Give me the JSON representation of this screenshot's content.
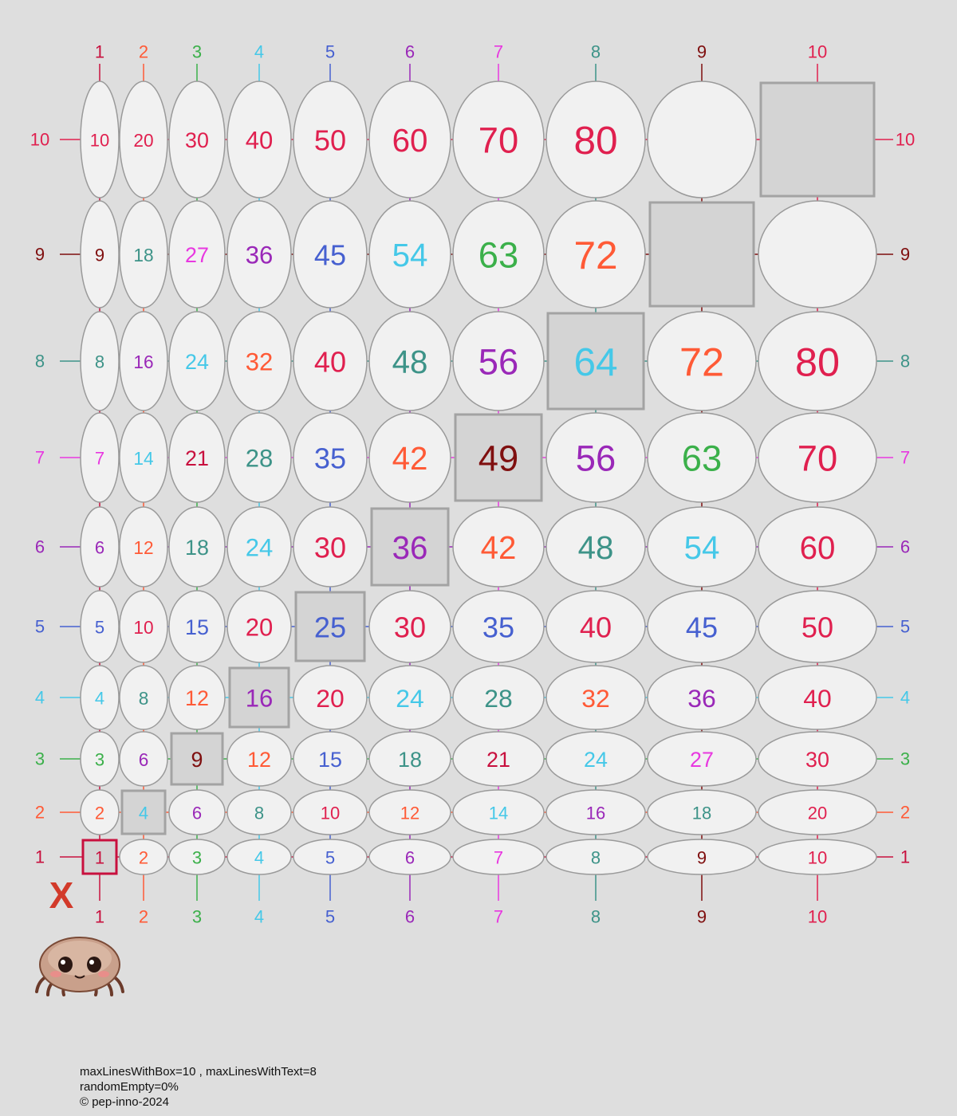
{
  "axis_values": [
    1,
    2,
    3,
    4,
    5,
    6,
    7,
    8,
    9,
    10
  ],
  "axis_colors": {
    "1": "#c8103e",
    "2": "#ff5a36",
    "3": "#3bb04a",
    "4": "#45c8e8",
    "5": "#4660d0",
    "6": "#9a28b8",
    "7": "#e838e0",
    "8": "#3d9388",
    "9": "#7f0f0f",
    "10": "#e0204f"
  },
  "operator_symbol": "X",
  "grid": {
    "rows": [
      10,
      9,
      8,
      7,
      6,
      5,
      4,
      3,
      2,
      1
    ],
    "hidden_cells": [
      "10x9",
      "10x10",
      "9x9",
      "9x10"
    ],
    "value_colors": {
      "1": "#c8103e",
      "2": "#ff5a36",
      "3": "#3bb04a",
      "4": "#45c8e8",
      "5": "#4660d0",
      "6": "#9a28b8",
      "7": "#e838e0",
      "8": "#3d9388",
      "9": "#7f0f0f",
      "10": "#e0204f",
      "12": "#ff5a36",
      "14": "#45c8e8",
      "15": "#4660d0",
      "16": "#9a28b8",
      "18": "#3d9388",
      "20": "#e0204f",
      "21": "#c8103e",
      "24": "#45c8e8",
      "25": "#4660d0",
      "27": "#e838e0",
      "28": "#3d9388",
      "30": "#e0204f",
      "32": "#ff5a36",
      "35": "#4660d0",
      "36": "#9a28b8",
      "40": "#e0204f",
      "42": "#ff5a36",
      "45": "#4660d0",
      "48": "#3d9388",
      "49": "#7f0f0f",
      "50": "#e0204f",
      "54": "#45c8e8",
      "56": "#9a28b8",
      "60": "#e0204f",
      "63": "#3bb04a",
      "64": "#45c8e8",
      "70": "#e0204f",
      "72": "#ff5a36",
      "80": "#e0204f",
      "81": "#7f0f0f",
      "90": "#e0204f",
      "100": "#e0204f"
    }
  },
  "footer": {
    "line1": "maxLinesWithBox=10 , maxLinesWithText=8",
    "line2": "randomEmpty=0%",
    "line3": "© pep-inno-2024"
  }
}
